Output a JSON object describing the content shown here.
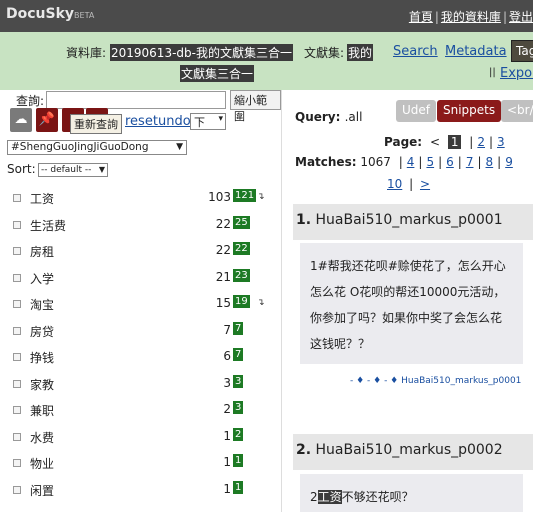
{
  "app": {
    "name": "DocuSky",
    "badge": "BETA"
  },
  "top_links": {
    "home": "首頁",
    "my_db": "我的資料庫",
    "logout": "登出"
  },
  "header": {
    "db_label": "資料庫:",
    "db_value": "20190613-db-我的文獻集三合一",
    "corpus_label": "文獻集:",
    "corpus_value_1": "我的",
    "corpus_value_2": "文獻集三合一",
    "search_link": "Search",
    "metadata_link": "Metadata",
    "tag_btn": "Tag",
    "export_prefix": "||",
    "export_link": "Expor"
  },
  "left": {
    "search_label": "查詢:",
    "narrow_btn": "縮小範圍",
    "tooltip": "重新查詢",
    "reset": "reset",
    "undo": "undo",
    "down_select": "下",
    "field_select": "#ShengGuoJingJiGuoDong",
    "sort_label": "Sort:",
    "sort_select": "-- default --",
    "facets": [
      {
        "name": "工资",
        "count": "103",
        "badge": "121",
        "expand": "↴"
      },
      {
        "name": "生活费",
        "count": "22",
        "badge": "25",
        "expand": ""
      },
      {
        "name": "房租",
        "count": "22",
        "badge": "22",
        "expand": ""
      },
      {
        "name": "入学",
        "count": "21",
        "badge": "23",
        "expand": ""
      },
      {
        "name": "淘宝",
        "count": "15",
        "badge": "19",
        "expand": "↴"
      },
      {
        "name": "房贷",
        "count": "7",
        "badge": "7",
        "expand": ""
      },
      {
        "name": "挣钱",
        "count": "6",
        "badge": "7",
        "expand": ""
      },
      {
        "name": "家教",
        "count": "3",
        "badge": "3",
        "expand": ""
      },
      {
        "name": "兼职",
        "count": "2",
        "badge": "3",
        "expand": ""
      },
      {
        "name": "水费",
        "count": "1",
        "badge": "2",
        "expand": ""
      },
      {
        "name": "物业",
        "count": "1",
        "badge": "1",
        "expand": ""
      },
      {
        "name": "闲置",
        "count": "1",
        "badge": "1",
        "expand": ""
      }
    ]
  },
  "right": {
    "query_label": "Query:",
    "query_value": ".all",
    "udef_btn": "Udef",
    "snippets_btn": "Snippets",
    "br_btn": "<br/>",
    "page_label": "Page:",
    "page_prev": "<",
    "page_current": "1",
    "pages_line1": [
      "2",
      "3"
    ],
    "matches_label": "Matches:",
    "matches_value": "1067",
    "pages_line2": [
      "4",
      "5",
      "6",
      "7",
      "8",
      "9"
    ],
    "pages_line3": [
      "10"
    ],
    "page_next": ">",
    "doc1": {
      "num": "1.",
      "title": "HuaBai510_markus_p0001",
      "text": "1#帮我还花呗#赊使花了，怎么开心怎么花 O花呗的帮还10000元活动，你参加了吗？如果你中奖了会怎么花这钱呢？？",
      "meta": "- ♦ - ♦ - ♦ HuaBai510_markus_p0001"
    },
    "doc2": {
      "num": "2.",
      "title": "HuaBai510_markus_p0002",
      "text_prefix": "2",
      "text_kw": "工资",
      "text_rest": "不够还花呗？"
    }
  }
}
